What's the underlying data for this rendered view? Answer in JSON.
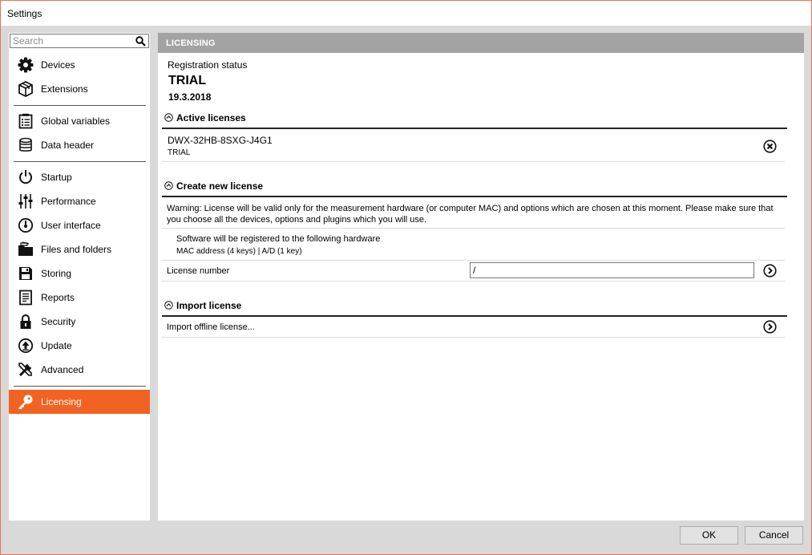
{
  "window": {
    "title": "Settings"
  },
  "search": {
    "placeholder": "Search"
  },
  "sidebar": {
    "items": [
      {
        "label": "Devices",
        "icon": "gear-icon"
      },
      {
        "label": "Extensions",
        "icon": "box-icon"
      },
      {
        "label": "Global variables",
        "icon": "list-icon"
      },
      {
        "label": "Data header",
        "icon": "database-icon"
      },
      {
        "label": "Startup",
        "icon": "power-icon"
      },
      {
        "label": "Performance",
        "icon": "sliders-icon"
      },
      {
        "label": "User interface",
        "icon": "gauge-icon"
      },
      {
        "label": "Files and folders",
        "icon": "folder-icon"
      },
      {
        "label": "Storing",
        "icon": "floppy-icon"
      },
      {
        "label": "Reports",
        "icon": "document-icon"
      },
      {
        "label": "Security",
        "icon": "lock-icon"
      },
      {
        "label": "Update",
        "icon": "update-icon"
      },
      {
        "label": "Advanced",
        "icon": "tools-icon"
      },
      {
        "label": "Licensing",
        "icon": "key-icon",
        "active": true
      }
    ]
  },
  "main": {
    "header": "LICENSING",
    "registration": {
      "label": "Registration status",
      "status": "TRIAL",
      "date": "19.3.2018"
    },
    "active_licenses": {
      "title": "Active licenses",
      "items": [
        {
          "key": "DWX-32HB-8SXG-J4G1",
          "type": "TRIAL"
        }
      ]
    },
    "create_license": {
      "title": "Create new license",
      "warning": "Warning: License will be valid only for the measurement hardware (or computer MAC) and options which are chosen at this moment. Please make sure that you choose all the devices, options and plugins which you will use.",
      "hardware_title": "Software will be registered to the following hardware",
      "hardware_detail": "MAC address (4 keys) | A/D (1 key)",
      "license_number_label": "License number",
      "license_number_value": "/"
    },
    "import_license": {
      "title": "Import license",
      "item": "Import offline license..."
    }
  },
  "footer": {
    "ok": "OK",
    "cancel": "Cancel"
  },
  "colors": {
    "accent": "#f26322",
    "header_bar": "#a3a3a3",
    "window_border": "#e8734a"
  }
}
